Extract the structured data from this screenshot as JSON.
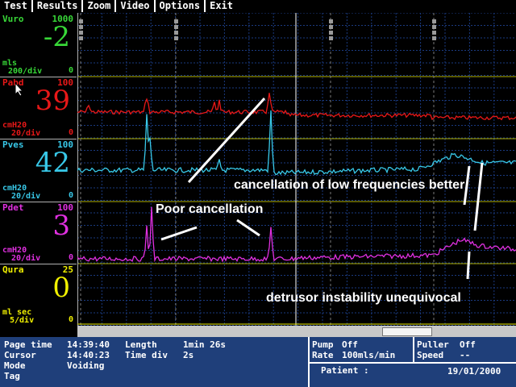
{
  "menu": [
    "Test",
    "Results",
    "Zoom",
    "Video",
    "Options",
    "Exit"
  ],
  "channels": [
    {
      "name": "Vuro",
      "max": "1000",
      "value": "-2",
      "unit": "mls",
      "scale": "200/div",
      "zero": "0",
      "color": "#38d838"
    },
    {
      "name": "Pabd",
      "max": "100",
      "value": "39",
      "unit": "cmH20",
      "scale": "20/div",
      "zero": "0",
      "color": "#e81818"
    },
    {
      "name": "Pves",
      "max": "100",
      "value": "42",
      "unit": "cmH20",
      "scale": "20/div",
      "zero": "0",
      "color": "#38c8e8"
    },
    {
      "name": "Pdet",
      "max": "100",
      "value": "3",
      "unit": "cmH20",
      "scale": "20/div",
      "zero": "0",
      "color": "#e030e0"
    },
    {
      "name": "Qura",
      "max": "25",
      "value": "0",
      "unit": "ml sec",
      "scale": "5/div",
      "zero": "0",
      "color": "#f0f000"
    }
  ],
  "annotations": {
    "poor": "Poor cancellation",
    "low_freq": "cancellation of low frequencies better",
    "detrusor": "detrusor instability unequivocal"
  },
  "status": {
    "page_time_label": "Page time",
    "page_time": "14:39:40",
    "length_label": "Length",
    "length": "1min 26s",
    "cursor_label": "Cursor",
    "cursor": "14:40:23",
    "time_div_label": "Time div",
    "time_div": "2s",
    "mode_label": "Mode",
    "mode": "Voiding",
    "tag_label": "Tag",
    "pump_label": "Pump",
    "pump": "Off",
    "rate_label": "Rate",
    "rate": "100mls/min",
    "puller_label": "Puller",
    "puller": "Off",
    "speed_label": "Speed",
    "speed": "--",
    "patient_label": "Patient :",
    "date": "19/01/2000"
  },
  "colors": {
    "grid": "#1a3a80",
    "menu_sep": "#ffffff",
    "status_bg": "#1f3f7a"
  }
}
